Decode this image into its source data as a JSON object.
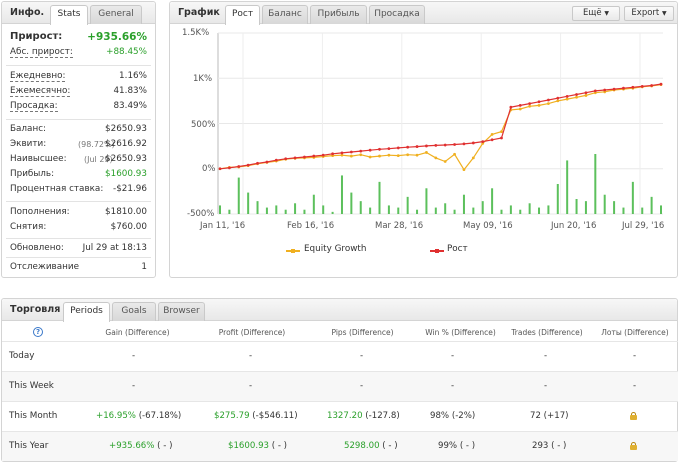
{
  "info": {
    "title": "Инфо.",
    "tabs": [
      "Stats",
      "General"
    ],
    "growth_label": "Прирост:",
    "growth_value": "+935.66%",
    "abs_growth_label": "Абс. прирост:",
    "abs_growth_value": "+88.45%",
    "daily_label": "Ежедневно:",
    "daily_value": "1.16%",
    "monthly_label": "Ежемесячно:",
    "monthly_value": "41.83%",
    "drawdown_label": "Просадка:",
    "drawdown_value": "83.49%",
    "balance_label": "Баланс:",
    "balance_value": "$2650.93",
    "equity_label": "Эквити:",
    "equity_pct": "(98.72%)",
    "equity_value": "$2616.92",
    "highest_label": "Наивысшее:",
    "highest_date": "(Jul 29)",
    "highest_value": "$2650.93",
    "profit_label": "Прибыль:",
    "profit_value": "$1600.93",
    "interest_label": "Процентная ставка:",
    "interest_value": "-$21.96",
    "deposits_label": "Пополнения:",
    "deposits_value": "$1810.00",
    "withdrawals_label": "Снятия:",
    "withdrawals_value": "$760.00",
    "updated_label": "Обновлено:",
    "updated_value": "Jul 29 at 18:13",
    "tracking_label": "Отслеживание",
    "tracking_value": "1"
  },
  "chart_panel": {
    "title": "График",
    "tabs": [
      "Рост",
      "Баланс",
      "Прибыль",
      "Просадка"
    ],
    "more_button": "Ещё",
    "export_button": "Export",
    "legend_equity": "Equity Growth",
    "legend_growth": "Рост"
  },
  "chart_data": {
    "type": "line",
    "yticks": [
      "1.5K%",
      "1K%",
      "500%",
      "0%",
      "-500%"
    ],
    "ytick_values": [
      1500,
      1000,
      500,
      0,
      -500
    ],
    "xticks": [
      "Jan 11, '16",
      "Feb 16, '16",
      "Mar 28, '16",
      "May 09, '16",
      "Jun 20, '16",
      "Jul 29, '16"
    ],
    "ylim": [
      -500,
      1500
    ],
    "series": [
      {
        "name": "Рост",
        "color": "#e03030",
        "values": [
          0,
          10,
          25,
          40,
          60,
          75,
          95,
          110,
          120,
          130,
          140,
          150,
          165,
          175,
          185,
          195,
          205,
          215,
          222,
          230,
          238,
          245,
          252,
          258,
          262,
          268,
          275,
          285,
          300,
          320,
          340,
          680,
          700,
          720,
          740,
          760,
          780,
          800,
          820,
          840,
          860,
          870,
          880,
          890,
          900,
          910,
          920,
          935
        ]
      },
      {
        "name": "Equity Growth",
        "color": "#f0b020",
        "values": [
          0,
          15,
          20,
          35,
          55,
          70,
          85,
          105,
          115,
          120,
          125,
          135,
          145,
          150,
          140,
          155,
          130,
          140,
          150,
          145,
          155,
          150,
          180,
          120,
          80,
          160,
          -10,
          120,
          280,
          380,
          410,
          650,
          660,
          690,
          700,
          720,
          750,
          770,
          790,
          810,
          840,
          850,
          870,
          880,
          890,
          905,
          915,
          930
        ]
      },
      {
        "name": "bars",
        "color": "#5cc05c",
        "values": [
          40,
          20,
          170,
          100,
          60,
          30,
          40,
          20,
          50,
          20,
          90,
          40,
          10,
          180,
          100,
          60,
          30,
          150,
          40,
          30,
          80,
          20,
          120,
          30,
          50,
          20,
          90,
          30,
          60,
          120,
          20,
          40,
          20,
          50,
          30,
          40,
          140,
          250,
          70,
          60,
          280,
          90,
          60,
          30,
          150,
          30,
          80,
          40
        ]
      }
    ]
  },
  "trading": {
    "title": "Торговля",
    "tabs": [
      "Periods",
      "Goals",
      "Browser"
    ],
    "help_icon": "?",
    "headers": [
      "Gain (Difference)",
      "Profit (Difference)",
      "Pips (Difference)",
      "Win % (Difference)",
      "Trades (Difference)",
      "Лоты (Difference)"
    ],
    "rows": [
      {
        "label": "Today",
        "gain": "-",
        "gain_diff": "",
        "profit": "-",
        "profit_diff": "",
        "pips": "-",
        "pips_diff": "",
        "win": "-",
        "win_diff": "",
        "trades": "-",
        "trades_diff": "",
        "lots": "-"
      },
      {
        "label": "This Week",
        "gain": "-",
        "gain_diff": "",
        "profit": "-",
        "profit_diff": "",
        "pips": "-",
        "pips_diff": "",
        "win": "-",
        "win_diff": "",
        "trades": "-",
        "trades_diff": "",
        "lots": "-"
      },
      {
        "label": "This Month",
        "gain": "+16.95%",
        "gain_diff": "(-67.18%)",
        "profit": "$275.79",
        "profit_diff": "(-$546.11)",
        "pips": "1327.20",
        "pips_diff": "(-127.8)",
        "win": "98%",
        "win_diff": "(-2%)",
        "trades": "72",
        "trades_diff": "(+17)",
        "lots": "lock-icon"
      },
      {
        "label": "This Year",
        "gain": "+935.66%",
        "gain_diff": "( - )",
        "profit": "$1600.93",
        "profit_diff": "( - )",
        "pips": "5298.00",
        "pips_diff": "( - )",
        "win": "99%",
        "win_diff": "( - )",
        "trades": "293",
        "trades_diff": "( - )",
        "lots": "lock-icon"
      }
    ]
  }
}
